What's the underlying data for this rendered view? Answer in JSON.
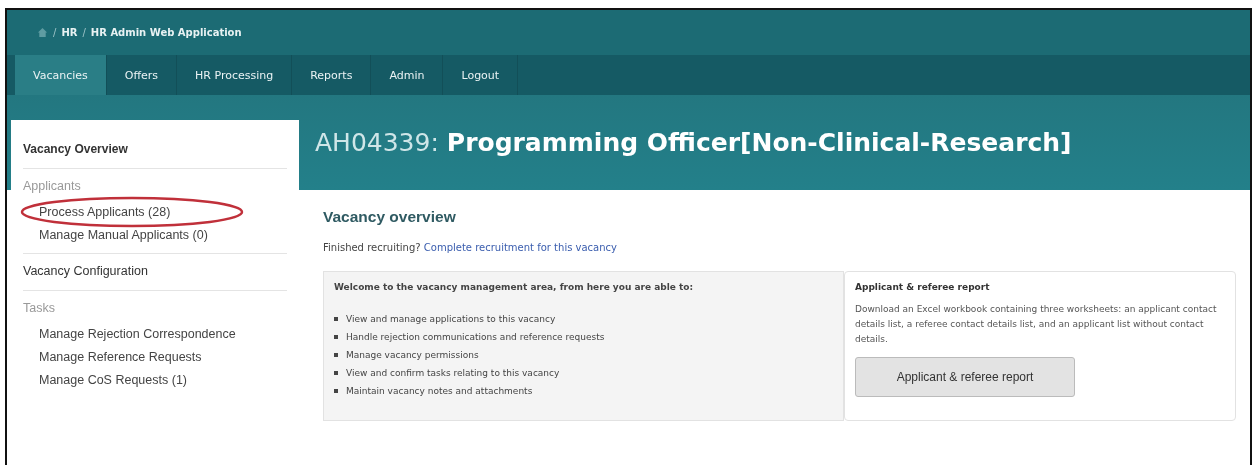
{
  "breadcrumb": {
    "separator": "/",
    "items": [
      "HR",
      "HR Admin Web Application"
    ]
  },
  "nav": {
    "tabs": [
      {
        "label": "Vacancies",
        "selected": true
      },
      {
        "label": "Offers",
        "selected": false
      },
      {
        "label": "HR Processing",
        "selected": false
      },
      {
        "label": "Reports",
        "selected": false
      },
      {
        "label": "Admin",
        "selected": false
      },
      {
        "label": "Logout",
        "selected": false
      }
    ]
  },
  "sidebar": {
    "sections": [
      {
        "kind": "link",
        "label": "Vacancy Overview",
        "bold": true
      },
      {
        "kind": "group",
        "label": "Applicants",
        "children": [
          {
            "label": "Process Applicants (28)",
            "circled": true
          },
          {
            "label": "Manage Manual Applicants (0)",
            "circled": false
          }
        ]
      },
      {
        "kind": "link",
        "label": "Vacancy Configuration",
        "bold": false
      },
      {
        "kind": "group",
        "label": "Tasks",
        "children": [
          {
            "label": "Manage Rejection Correspondence",
            "circled": false
          },
          {
            "label": "Manage Reference Requests",
            "circled": false
          },
          {
            "label": "Manage CoS Requests (1)",
            "circled": false
          }
        ]
      }
    ]
  },
  "page_title": "AH04339: **Programming Officer[Non-Clinical-Research]**",
  "overview": {
    "heading": "Vacancy overview",
    "prompt": "Finished recruiting?",
    "link": "Complete recruitment for this vacancy"
  },
  "welcome": {
    "intro": "Welcome to the vacancy management area, from here you are able to:",
    "items": [
      "View and manage applications to this vacancy",
      "Handle rejection communications and reference requests",
      "Manage vacancy permissions",
      "View and confirm tasks relating to this vacancy",
      "Maintain vacancy notes and attachments"
    ]
  },
  "report": {
    "title": "Applicant & referee report",
    "description": "Download an Excel workbook containing three worksheets: an applicant contact details list, a referee contact details list, and an applicant list without contact details.",
    "button": "Applicant & referee report"
  }
}
